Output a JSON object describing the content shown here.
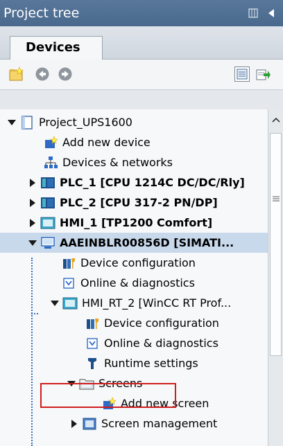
{
  "panel": {
    "title": "Project tree"
  },
  "tabs": [
    {
      "label": "Devices"
    }
  ],
  "colors": {
    "titlebar": "#4f6f93",
    "selected_row": "#c9d9ec",
    "highlight": "#d01c1c",
    "tree_line": "#3a6fc4"
  },
  "tree": [
    {
      "label": "Project_UPS1600",
      "icon": "project-icon",
      "expanded": true
    },
    {
      "label": "Add new device",
      "icon": "add-device-icon"
    },
    {
      "label": "Devices & networks",
      "icon": "network-icon"
    },
    {
      "label": "PLC_1 [CPU 1214C DC/DC/Rly]",
      "icon": "plc-icon",
      "expanded": false
    },
    {
      "label": "PLC_2 [CPU 317-2 PN/DP]",
      "icon": "plc-icon",
      "expanded": false
    },
    {
      "label": "HMI_1 [TP1200 Comfort]",
      "icon": "hmi-icon",
      "expanded": false
    },
    {
      "label": "AAEINBLR00856D [SIMATI...",
      "icon": "pc-station-icon",
      "expanded": true,
      "selected": true
    },
    {
      "label": "Device configuration",
      "icon": "device-config-icon"
    },
    {
      "label": "Online & diagnostics",
      "icon": "diagnostics-icon"
    },
    {
      "label": "HMI_RT_2 [WinCC RT Prof...",
      "icon": "hmi-runtime-icon",
      "expanded": true
    },
    {
      "label": "Device configuration",
      "icon": "device-config-icon"
    },
    {
      "label": "Online & diagnostics",
      "icon": "diagnostics-icon"
    },
    {
      "label": "Runtime settings",
      "icon": "runtime-settings-icon"
    },
    {
      "label": "Screens",
      "icon": "folder-icon",
      "expanded": true,
      "highlighted": true
    },
    {
      "label": "Add new screen",
      "icon": "add-screen-icon"
    },
    {
      "label": "Screen management",
      "icon": "screen-management-icon",
      "expanded": false
    }
  ]
}
